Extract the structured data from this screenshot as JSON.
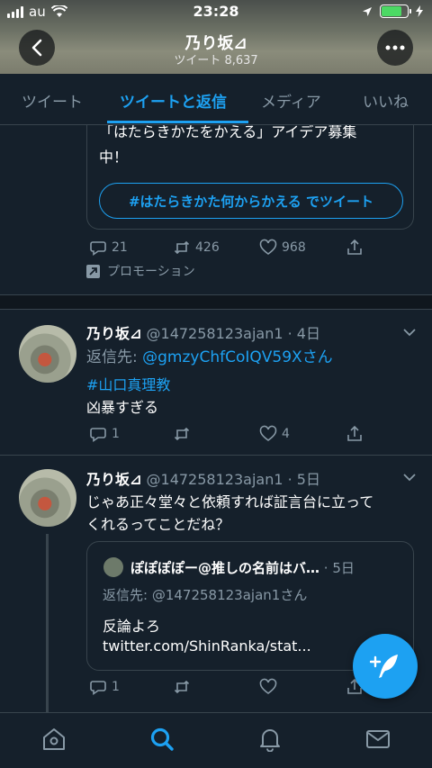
{
  "status_bar": {
    "carrier": "au",
    "time": "23:28"
  },
  "header": {
    "title": "乃り坂⊿",
    "subtitle": "ツイート 8,637"
  },
  "tabs": [
    {
      "label": "ツイート",
      "active": false
    },
    {
      "label": "ツイートと返信",
      "active": true
    },
    {
      "label": "メディア",
      "active": false
    },
    {
      "label": "いいね",
      "active": false
    }
  ],
  "promo_tweet": {
    "text_line1": "「はたらきかたをかえる」アイデア募集",
    "text_line2": "中！",
    "button": "#はたらきかた何からかえる でツイート",
    "replies": "21",
    "retweets": "426",
    "likes": "968",
    "promoted_label": "プロモーション"
  },
  "tweets": [
    {
      "name": "乃り坂⊿",
      "handle_time": "@147258123ajan1 · 4日",
      "reply_to_prefix": "返信先: ",
      "reply_to_user": "@gmzyChfCoIQV59X",
      "reply_to_suffix": "さん",
      "hashtag": "#山口真理教",
      "text": "凶暴すぎる",
      "replies": "1",
      "retweets": "",
      "likes": "4"
    },
    {
      "name": "乃り坂⊿",
      "handle_time": "@147258123ajan1 · 5日",
      "text_line1": "じゃあ正々堂々と依頼すれば証言台に立って",
      "text_line2": "くれるってことだね？",
      "replies": "1",
      "quote": {
        "name": "ぽぽぽぽー@推しの名前はバ…",
        "time": "· 5日",
        "reply_to": "返信先: @147258123ajan1さん",
        "text_line1": "反論よろ",
        "text_line2": "twitter.com/ShinRanka/stat..."
      }
    }
  ],
  "colors": {
    "accent": "#1da1f2",
    "background": "#15202b",
    "muted": "#8899a6",
    "border": "#38444d"
  }
}
